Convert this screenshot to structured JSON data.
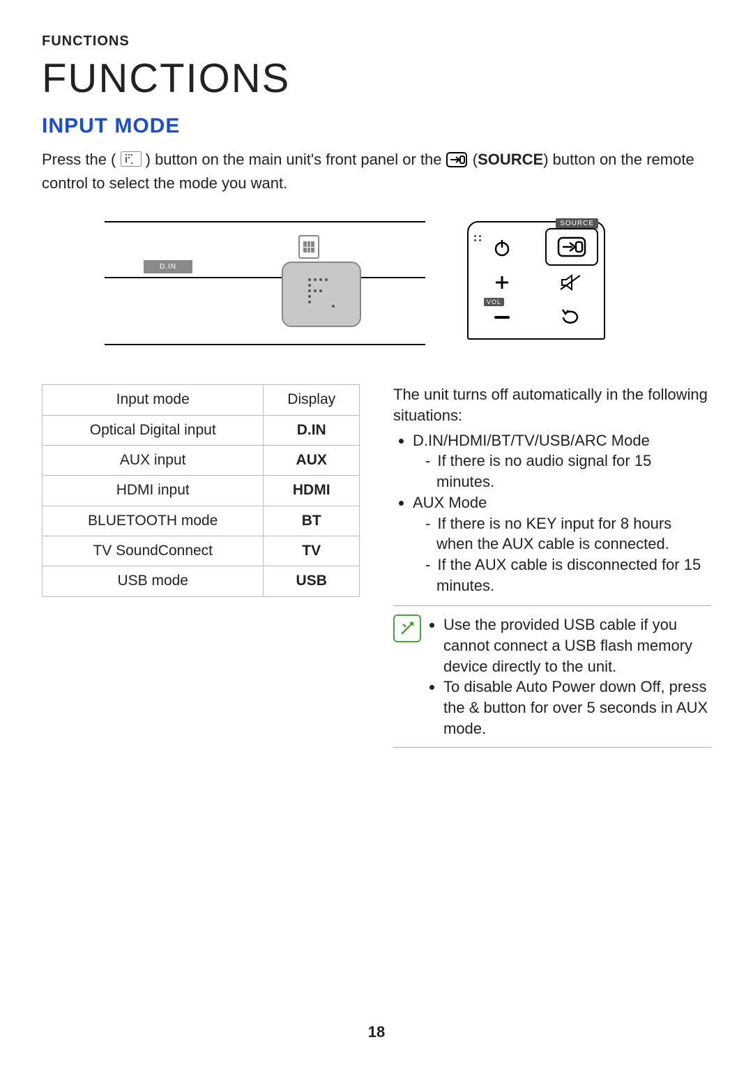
{
  "header_small": "FUNCTIONS",
  "title_large": "FUNCTIONS",
  "section_heading": "INPUT MODE",
  "intro": {
    "pre": "Press the (",
    "mid_a": ") button on the main unit's front panel or the ",
    "source_bold": "SOURCE",
    "mid_b": ") button on the remote control to select the mode you want."
  },
  "diagram": {
    "din_label": "D.IN",
    "remote_source_label": "SOURCE",
    "remote_vol_label": "VOL"
  },
  "table": {
    "head_mode": "Input mode",
    "head_display": "Display",
    "rows": [
      {
        "mode": "Optical Digital input",
        "display": "D.IN"
      },
      {
        "mode": "AUX input",
        "display": "AUX"
      },
      {
        "mode": "HDMI input",
        "display": "HDMI"
      },
      {
        "mode": "BLUETOOTH mode",
        "display": "BT"
      },
      {
        "mode": "TV SoundConnect",
        "display": "TV"
      },
      {
        "mode": "USB mode",
        "display": "USB"
      }
    ]
  },
  "right": {
    "lead": "The unit turns off automatically in the following situations:",
    "b1": "D.IN/HDMI/BT/TV/USB/ARC Mode",
    "b1_sub1": "If there is no audio signal for 15 minutes.",
    "b2": "AUX Mode",
    "b2_sub1": "If there is no KEY input for 8 hours when the AUX cable is connected.",
    "b2_sub2": "If the AUX cable is disconnected for 15 minutes.",
    "note1": "Use the provided USB cable if you cannot connect a USB flash memory device directly to the unit.",
    "note2_a": "To disable Auto Power down Off, press the ",
    "note2_btn": "&",
    "note2_b": " button for over 5 seconds in AUX mode."
  },
  "page_number": "18"
}
